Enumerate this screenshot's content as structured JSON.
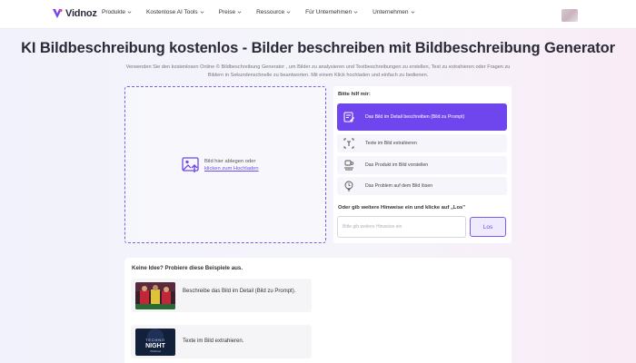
{
  "brand": {
    "name": "Vidnoz"
  },
  "nav": {
    "items": [
      {
        "label": "Produkte"
      },
      {
        "label": "Kostenlose AI Tools"
      },
      {
        "label": "Preise"
      },
      {
        "label": "Ressource"
      },
      {
        "label": "Für Unternehmen"
      },
      {
        "label": "Unternehmen"
      }
    ]
  },
  "header": {
    "title": "KI Bildbeschreibung kostenlos - Bilder beschreiben mit Bildbeschreibung Generator",
    "description": "Verwenden Sie den kostenlosen Online © Bildbeschreibung Generator , um Bilder zu analysieren und Textbeschreibungen zu erstellen, Text zu extrahieren oder Fragen zu Bildern in Sekundenschnelle zu beantworten. Mit einem Klick hochladen und einfach zu bedienen."
  },
  "upload": {
    "text": "Bild hier ablegen oder",
    "link": "klicken zum Hochladen"
  },
  "panel": {
    "heading": "Bitte hilf mir:",
    "options": [
      {
        "label": "Das Bild im Detail beschreiben (Bild zu Prompt)",
        "icon": "image-edit-icon",
        "active": true
      },
      {
        "label": "Texte im Bild extrahieren",
        "icon": "text-scan-icon",
        "active": false
      },
      {
        "label": "Das Produkt im Bild vorstellen",
        "icon": "product-icon",
        "active": false
      },
      {
        "label": "Das Problem auf dem Bild lösen",
        "icon": "bulb-icon",
        "active": false
      }
    ],
    "hint": "Oder gib weitere Hinweise ein und klicke auf „Los\"",
    "input_placeholder": "Bitte gib weitere Hinweise ein",
    "button": "Los"
  },
  "examples": {
    "heading": "Keine Idee? Probiere diese Beispiele aus.",
    "items": [
      {
        "text": "Beschreibe das Bild im Detail (Bild zu Prompt)."
      },
      {
        "text": "Texte im Bild extrahieren."
      }
    ],
    "thumb2_text": {
      "line1": "TECHNO",
      "line2": "NIGHT",
      "line3": "Festival"
    }
  },
  "colors": {
    "accent": "#6f46ee",
    "accent_light": "#efeafd"
  }
}
